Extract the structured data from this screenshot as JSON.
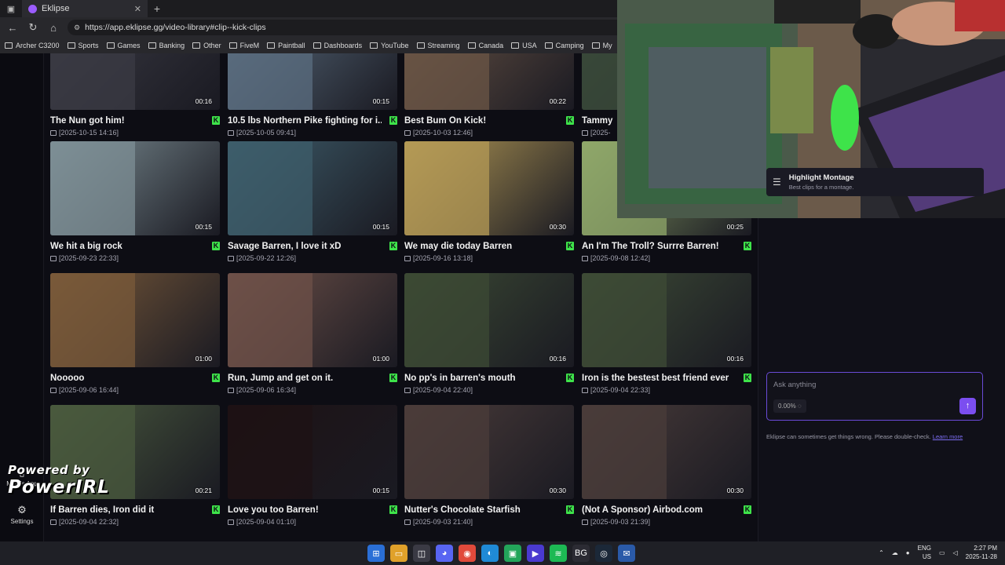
{
  "browser": {
    "tab_title": "Eklipse",
    "url": "https://app.eklipse.gg/video-library#clip--kick-clips",
    "bookmarks": [
      "Archer C3200",
      "Sports",
      "Games",
      "Banking",
      "Other",
      "FiveM",
      "Paintball",
      "Dashboards",
      "YouTube",
      "Streaming",
      "Canada",
      "USA",
      "Camping",
      "My"
    ]
  },
  "nav": {
    "mobile_app": "Mobile App",
    "settings": "Settings"
  },
  "clips": [
    {
      "title": "The Nun got him!",
      "date": "[2025-10-15 14:16]",
      "duration": "00:16",
      "thumb_color": "#3b3b44"
    },
    {
      "title": "10.5 lbs Northern Pike fighting for i...",
      "date": "[2025-10-05 09:41]",
      "duration": "00:15",
      "thumb_color": "#5b6e80"
    },
    {
      "title": "Best Bum On Kick!",
      "date": "[2025-10-03 12:46]",
      "duration": "00:22",
      "thumb_color": "#6b5546"
    },
    {
      "title": "Tammy",
      "date": "[2025-",
      "duration": "",
      "thumb_color": "#3a4a3a"
    },
    {
      "title": "We hit a big rock",
      "date": "[2025-09-23 22:33]",
      "duration": "00:15",
      "thumb_color": "#7d8f95"
    },
    {
      "title": "Savage Barren, I love it xD",
      "date": "[2025-09-22 12:26]",
      "duration": "00:15",
      "thumb_color": "#3e5d6b"
    },
    {
      "title": "We may die today Barren",
      "date": "[2025-09-16 13:18]",
      "duration": "00:30",
      "thumb_color": "#b49a56"
    },
    {
      "title": "An I'm The Troll? Surrre Barren!",
      "date": "[2025-09-08 12:42]",
      "duration": "00:25",
      "thumb_color": "#8fa76a"
    },
    {
      "title": "Nooooo",
      "date": "[2025-09-06 16:44]",
      "duration": "01:00",
      "thumb_color": "#7a5a3a"
    },
    {
      "title": "Run, Jump and get on it.",
      "date": "[2025-09-06 16:34]",
      "duration": "01:00",
      "thumb_color": "#6d5048"
    },
    {
      "title": "No pp's in barren's mouth",
      "date": "[2025-09-04 22:40]",
      "duration": "00:16",
      "thumb_color": "#3c4a34"
    },
    {
      "title": "Iron is the bestest best friend ever",
      "date": "[2025-09-04 22:33]",
      "duration": "00:16",
      "thumb_color": "#3d4b36"
    },
    {
      "title": "If Barren dies, Iron did it",
      "date": "[2025-09-04 22:32]",
      "duration": "00:21",
      "thumb_color": "#4a5a3e"
    },
    {
      "title": "Love you too Barren!",
      "date": "[2025-09-04 01:10]",
      "duration": "00:15",
      "thumb_color": "#1e1214"
    },
    {
      "title": "Nutter's Chocolate Starfish",
      "date": "[2025-09-03 21:40]",
      "duration": "00:30",
      "thumb_color": "#4b3c3a"
    },
    {
      "title": "(Not A Sponsor) Airbod.com",
      "date": "[2025-09-03 21:39]",
      "duration": "00:30",
      "thumb_color": "#4a3c3a"
    }
  ],
  "panel": {
    "montage_title": "Highlight Montage",
    "montage_sub": "Best clips for a montage.",
    "ask_placeholder": "Ask anything",
    "credit_pct": "0.00%",
    "disclaimer": "Eklipse can sometimes get things wrong. Please double-check.",
    "learn_more": "Learn more"
  },
  "watermark": {
    "line1": "Powered by",
    "line2": "PowerIRL"
  },
  "taskbar": {
    "lang1": "ENG",
    "lang2": "US",
    "time": "2:27 PM",
    "date": "2025-11-28"
  },
  "colors": {
    "accent": "#7b4ef0",
    "kick_green": "#3ee34a",
    "bg": "#0d0d14"
  }
}
